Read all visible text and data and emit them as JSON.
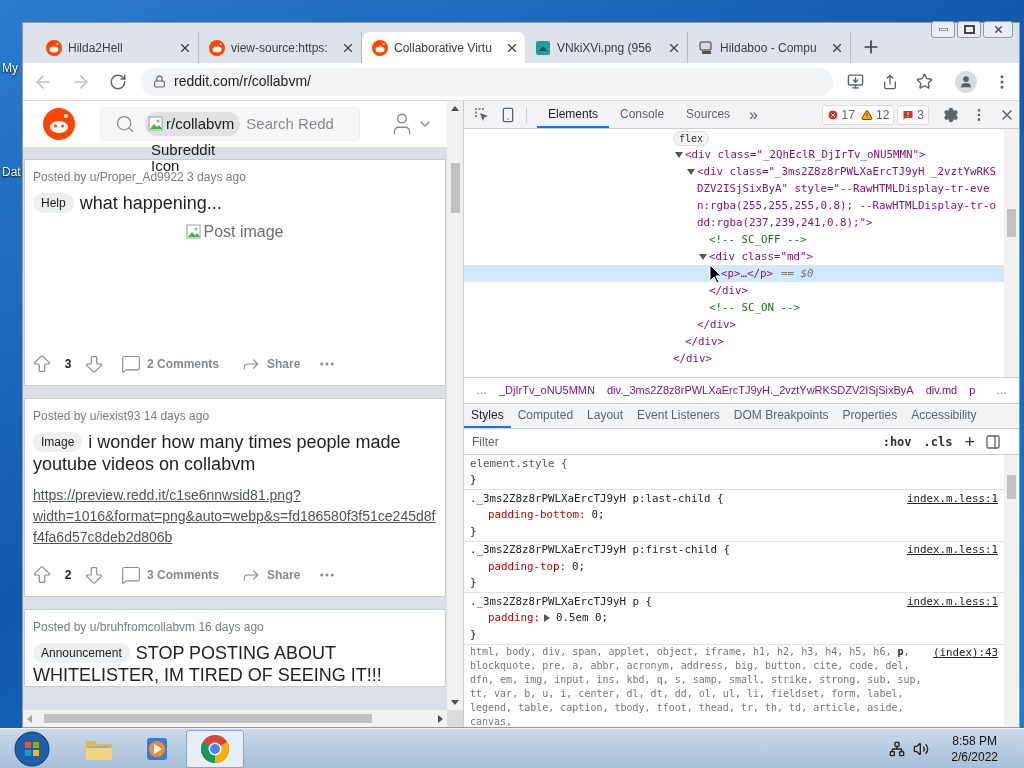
{
  "desktop": {
    "icons": [
      {
        "label": "My"
      },
      {
        "label": "Dat"
      }
    ]
  },
  "browser": {
    "tabs": [
      {
        "title": "Hilda2Hell",
        "kind": "reddit",
        "selected": false
      },
      {
        "title": "view-source:https:",
        "kind": "reddit",
        "selected": false
      },
      {
        "title": "Collaborative Virtu",
        "kind": "reddit",
        "selected": true
      },
      {
        "title": "VNkiXVi.png (956",
        "kind": "image",
        "selected": false
      },
      {
        "title": "Hildaboo - Compu",
        "kind": "computer",
        "selected": false
      }
    ],
    "back_disabled": true,
    "forward_disabled": true,
    "url": "reddit.com/r/collabvm/"
  },
  "reddit": {
    "search": {
      "chip": "r/collabvm",
      "chip_icon_alt": "Subreddit Icon",
      "placeholder": "Search Redd"
    },
    "posts": [
      {
        "meta": "Posted by u/Proper_Ad9922 3 days ago",
        "flair": "Help",
        "title": "what happening...",
        "kind": "image",
        "image_alt": "Post image",
        "votes": "3",
        "comments": "2 Comments",
        "share": "Share"
      },
      {
        "meta": "Posted by u/iexist93 14 days ago",
        "flair": "Image",
        "title": "i wonder how many times people made youtube videos on collabvm",
        "kind": "link",
        "link": "https://preview.redd.it/c1se6nnwsid81.png?width=1016&format=png&auto=webp&s=fd186580f3f51ce245d8ff4fa6d57c8deb2d806b",
        "votes": "2",
        "comments": "3 Comments",
        "share": "Share"
      },
      {
        "meta": "Posted by u/bruhfromcollabvm 16 days ago",
        "flair": "Announcement",
        "title": "STOP POSTING ABOUT WHITELISTER, IM TIRED OF SEEING IT!!!",
        "kind": "text"
      }
    ]
  },
  "devtools": {
    "tabs": [
      {
        "label": "Elements",
        "selected": true
      },
      {
        "label": "Console",
        "selected": false
      },
      {
        "label": "Sources",
        "selected": false
      }
    ],
    "more_tabs": "»",
    "errors": "17",
    "warnings": "12",
    "issues": "3",
    "dom_tree": [
      {
        "kind": "badge",
        "badge": "flex",
        "selected": false,
        "children": [
          {
            "kind": "element",
            "text": "<div class=\"_2QhEclR_DjIrTv_oNU5MMN\">",
            "expanded": true,
            "selected": false,
            "children": [
              {
                "kind": "element",
                "text": "<div class=\"_3ms2Z8z8rPWLXaErcTJ9yH _2vztYwRKSDZV2ISjSixByA\" style=\"--RawHTMLDisplay-tr-even:rgba(255,255,255,0.8); --RawHTMLDisplay-tr-odd:rgba(237,239,241,0.8);\">",
                "expanded": true,
                "selected": false,
                "children": [
                  {
                    "kind": "comment",
                    "text": "<!-- SC_OFF -->",
                    "selected": false
                  },
                  {
                    "kind": "element",
                    "text": "<div class=\"md\">",
                    "expanded": true,
                    "selected": false,
                    "children": [
                      {
                        "kind": "element",
                        "text": "<p>…</p>",
                        "suffix": "== $0",
                        "selected": true
                      }
                    ]
                  },
                  {
                    "kind": "close",
                    "text": "</div>",
                    "selected": false
                  },
                  {
                    "kind": "comment",
                    "text": "<!-- SC_ON -->",
                    "selected": false
                  }
                ]
              },
              {
                "kind": "close",
                "text": "</div>",
                "selected": false
              }
            ]
          },
          {
            "kind": "close",
            "text": "</div>",
            "selected": false
          }
        ]
      },
      {
        "kind": "close",
        "text": "</div>",
        "selected": false
      }
    ],
    "breadcrumbs": {
      "start": "…",
      "items": [
        "_DjIrTv_oNU5MMN",
        "div._3ms2Z8z8rPWLXaErcTJ9yH._2vztYwRKSDZV2ISjSixByA",
        "div.md",
        "p"
      ],
      "end": "…"
    },
    "style_tabs": [
      {
        "label": "Styles",
        "selected": true
      },
      {
        "label": "Computed",
        "selected": false
      },
      {
        "label": "Layout",
        "selected": false
      },
      {
        "label": "Event Listeners",
        "selected": false
      },
      {
        "label": "DOM Breakpoints",
        "selected": false
      },
      {
        "label": "Properties",
        "selected": false
      },
      {
        "label": "Accessibility",
        "selected": false
      }
    ],
    "filter": {
      "placeholder": "Filter",
      "hov": ":hov",
      "cls": ".cls",
      "add": "+"
    },
    "rules": [
      {
        "kind": "inline",
        "selector": "element.style {",
        "close": "}"
      },
      {
        "kind": "author",
        "selector": "._3ms2Z8z8rPWLXaErcTJ9yH p:last-child {",
        "source": "index.m.less:1",
        "declarations": [
          {
            "property": "padding-bottom:",
            "value": "0;",
            "expandable": false
          }
        ],
        "close": "}"
      },
      {
        "kind": "author",
        "selector": "._3ms2Z8z8rPWLXaErcTJ9yH p:first-child {",
        "source": "index.m.less:1",
        "declarations": [
          {
            "property": "padding-top:",
            "value": "0;",
            "expandable": false
          }
        ],
        "close": "}"
      },
      {
        "kind": "author",
        "selector": "._3ms2Z8z8rPWLXaErcTJ9yH p {",
        "source": "index.m.less:1",
        "declarations": [
          {
            "property": "padding:",
            "value": "0.5em 0;",
            "expandable": true
          }
        ],
        "close": "}"
      },
      {
        "kind": "reset",
        "selector": "html, body, div, span, applet, object, iframe, h1, h2, h3, h4, h5, h6, **p**, blockquote, pre, a, abbr, acronym, address, big, button, cite, code, del, dfn, em, img, input, ins, kbd, q, s, samp, small, strike, strong, sub, sup, tt, var, b, u, i, center, dl, dt, dd, ol, ul, li, fieldset, form, label, legend, table, caption, tbody, tfoot, thead, tr, th, td, article, aside, canvas,",
        "source": "(index):43"
      }
    ]
  },
  "taskbar": {
    "apps": [
      {
        "kind": "explorer",
        "active": false
      },
      {
        "kind": "media",
        "active": false
      },
      {
        "kind": "chrome",
        "active": true
      }
    ],
    "time": "8:58 PM",
    "date": "2/6/2022"
  }
}
